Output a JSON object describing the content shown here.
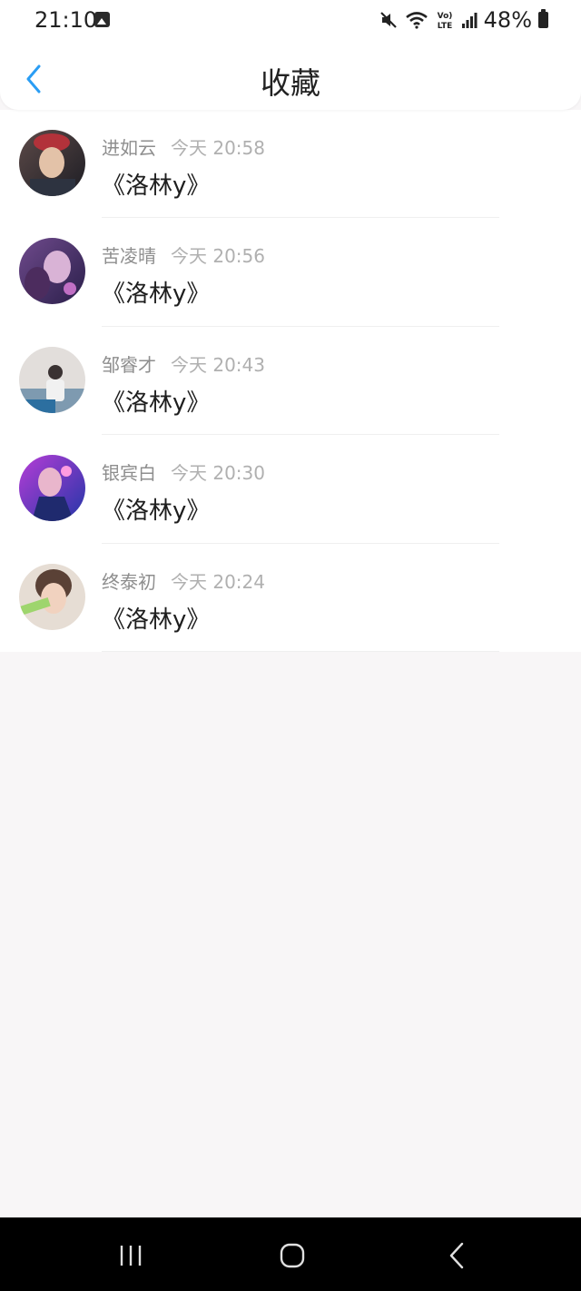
{
  "status_bar": {
    "time": "21:10",
    "battery_percent": "48%",
    "lte_label": "Vo) LTE"
  },
  "header": {
    "title": "收藏",
    "back_icon": "chevron-left-icon"
  },
  "favorites": [
    {
      "name": "进如云",
      "time": "今天 20:58",
      "content": "《洛林y》"
    },
    {
      "name": "苦凌晴",
      "time": "今天 20:56",
      "content": "《洛林y》"
    },
    {
      "name": "邹睿才",
      "time": "今天 20:43",
      "content": "《洛林y》"
    },
    {
      "name": "银宾白",
      "time": "今天 20:30",
      "content": "《洛林y》"
    },
    {
      "name": "终泰初",
      "time": "今天 20:24",
      "content": "《洛林y》"
    }
  ],
  "colors": {
    "accent": "#2a9df4",
    "page_background": "#f8f6f7"
  },
  "system_nav": {
    "recents_icon": "recents-icon",
    "home_icon": "home-icon",
    "back_icon": "back-icon"
  }
}
